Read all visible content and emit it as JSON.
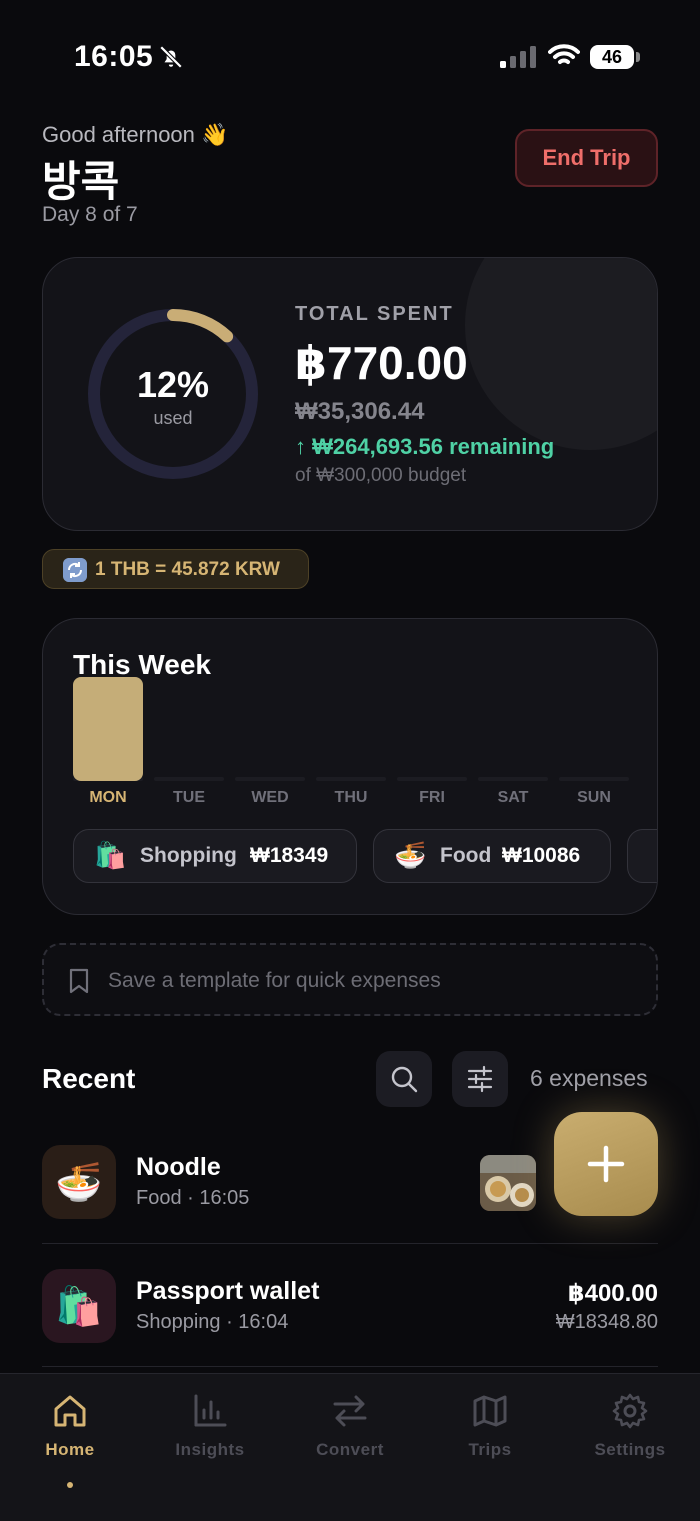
{
  "status_bar": {
    "time": "16:05",
    "battery": "46"
  },
  "header": {
    "greeting": "Good afternoon 👋",
    "trip_name": "방콕",
    "day_info": "Day 8 of 7",
    "end_trip_label": "End Trip"
  },
  "summary": {
    "percent_used": "12%",
    "used_label": "used",
    "used_fraction": 0.12,
    "total_label": "TOTAL SPENT",
    "total_amount": "฿770.00",
    "converted_amount": "₩35,306.44",
    "remaining": "↑ ₩264,693.56 remaining",
    "budget": "of ₩300,000 budget"
  },
  "rate": {
    "text": "1 THB = 45.872 KRW"
  },
  "week": {
    "title": "This Week",
    "days": [
      {
        "label": "MON",
        "value": 1.0,
        "active": true
      },
      {
        "label": "TUE",
        "value": 0,
        "active": false
      },
      {
        "label": "WED",
        "value": 0,
        "active": false
      },
      {
        "label": "THU",
        "value": 0,
        "active": false
      },
      {
        "label": "FRI",
        "value": 0,
        "active": false
      },
      {
        "label": "SAT",
        "value": 0,
        "active": false
      },
      {
        "label": "SUN",
        "value": 0,
        "active": false
      }
    ],
    "categories": [
      {
        "icon": "🛍️",
        "name": "Shopping",
        "amount": "₩18349"
      },
      {
        "icon": "🍜",
        "name": "Food",
        "amount": "₩10086"
      }
    ]
  },
  "template_prompt": "Save a template for quick expenses",
  "recent": {
    "title": "Recent",
    "count": "6 expenses",
    "items": [
      {
        "icon": "🍜",
        "name": "Noodle",
        "meta": "Food · 16:05",
        "amount": "",
        "converted": ""
      },
      {
        "icon": "🛍️",
        "name": "Passport wallet",
        "meta": "Shopping · 16:04",
        "amount": "฿400.00",
        "converted": "₩18348.80"
      }
    ]
  },
  "tabs": [
    {
      "label": "Home",
      "icon": "home-icon",
      "active": true
    },
    {
      "label": "Insights",
      "icon": "bar-chart-icon",
      "active": false
    },
    {
      "label": "Convert",
      "icon": "swap-arrows-icon",
      "active": false
    },
    {
      "label": "Trips",
      "icon": "map-icon",
      "active": false
    },
    {
      "label": "Settings",
      "icon": "gear-icon",
      "active": false
    }
  ],
  "colors": {
    "accent": "#d6b574",
    "danger": "#ef6e6a",
    "success": "#4fd1a5",
    "background": "#0a0a0d",
    "card": "#131318"
  }
}
